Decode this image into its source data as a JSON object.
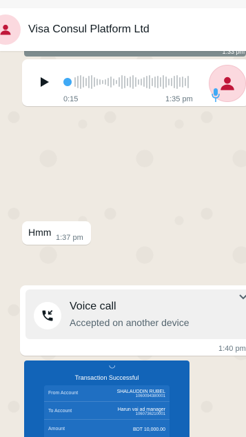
{
  "header": {
    "title": "Visa Consul Platform Ltd",
    "prev_image_time": "1:33 pm"
  },
  "voice_message": {
    "duration": "0:15",
    "time": "1:35 pm"
  },
  "messages": [
    {
      "text": "Hmm",
      "time": "1:37 pm"
    }
  ],
  "voice_call": {
    "title": "Voice call",
    "subtitle": "Accepted on another device",
    "time": "1:40 pm"
  },
  "receipt": {
    "title": "Transaction Successful",
    "rows": [
      {
        "label": "From Account",
        "value": "SHALAUDDIN RUBEL",
        "sub": "1060094380001"
      },
      {
        "label": "To Account",
        "value": "Harun vai ad manager",
        "sub": "1060736210001"
      },
      {
        "label": "Amount",
        "value": "BDT 10,000.00",
        "sub": ""
      }
    ]
  },
  "colors": {
    "chat_bg": "#efeae2",
    "bubble": "#ffffff",
    "avatar_bg": "#fbd9df",
    "avatar_icon": "#c0173a",
    "wave": "#c4c9cc",
    "wave_dot": "#3fa9f5",
    "receipt_blue": "#1264b8"
  },
  "icons": {
    "avatar": "person-icon",
    "play": "play-icon",
    "mic": "mic-icon",
    "call": "incoming-call-icon",
    "chevron": "chevron-down-icon"
  }
}
